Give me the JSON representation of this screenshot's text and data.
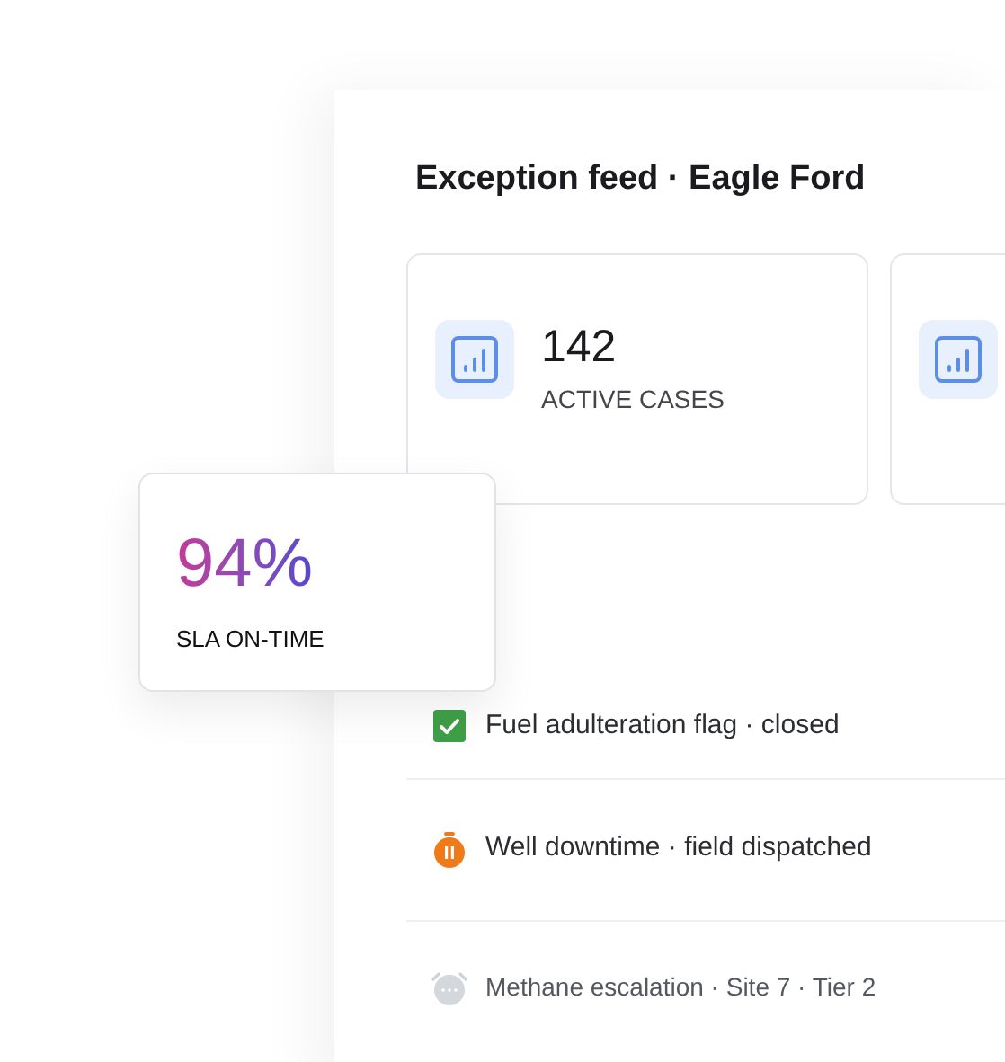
{
  "panel": {
    "title": "Exception feed · Eagle Ford"
  },
  "stat_cards": [
    {
      "kind": "full",
      "value": "142",
      "label": "ACTIVE CASES"
    },
    {
      "kind": "partial"
    }
  ],
  "floating_card": {
    "value": "94%",
    "label": "SLA ON-TIME"
  },
  "events": [
    {
      "kind": "closed",
      "text": "Fuel adulteration flag · closed"
    },
    {
      "kind": "dispatched",
      "text": "Well downtime · field dispatched"
    },
    {
      "kind": "pending",
      "text": "Methane escalation · Site 7 · Tier 2"
    }
  ]
}
